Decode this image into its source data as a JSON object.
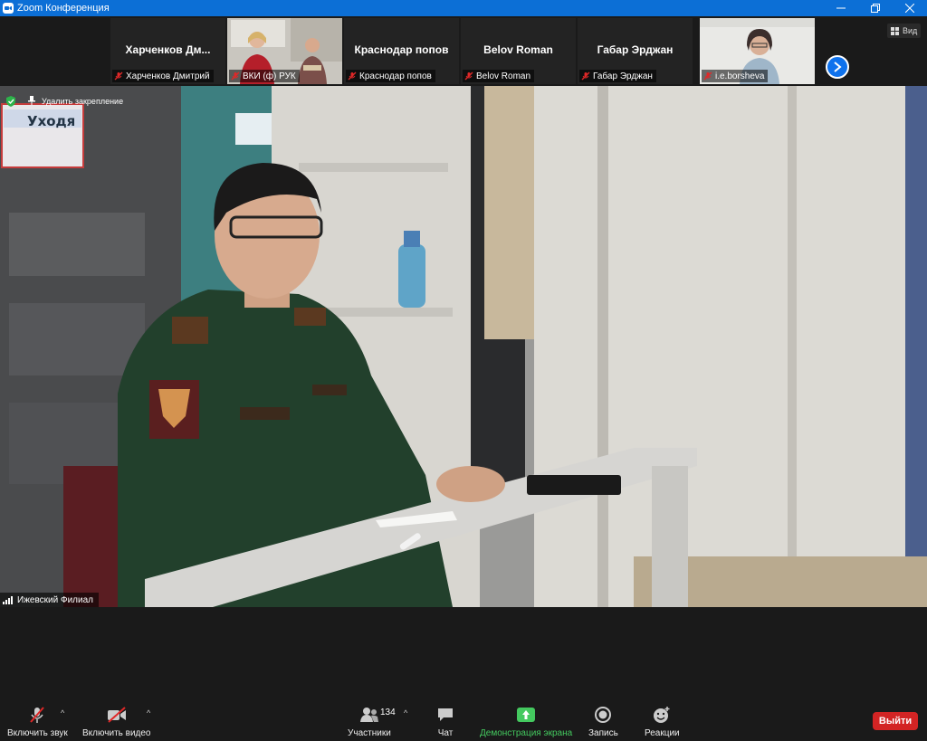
{
  "window": {
    "title": "Zoom Конференция"
  },
  "participants_strip": [
    {
      "big_name": "Харченков  Дм...",
      "label": "Харченков Дмитрий",
      "has_video": false,
      "muted": true
    },
    {
      "big_name": "",
      "label": "ВКИ (ф) РУК",
      "has_video": true,
      "muted": true
    },
    {
      "big_name": "Краснодар попов",
      "label": "Краснодар попов",
      "has_video": false,
      "muted": true
    },
    {
      "big_name": "Belov Roman",
      "label": "Belov Roman",
      "has_video": false,
      "muted": true
    },
    {
      "big_name": "Габар Эрджан",
      "label": "Габар Эрджан",
      "has_video": false,
      "muted": true
    },
    {
      "big_name": "",
      "label": "i.e.borsheva",
      "has_video": true,
      "muted": true
    }
  ],
  "view_button": {
    "label": "Вид"
  },
  "pinned": {
    "unpin_label": "Удалить закрепление",
    "speaker_name": "Ижевский Филиал",
    "sign_text": "Уходя"
  },
  "toolbar": {
    "audio_label": "Включить звук",
    "video_label": "Включить видео",
    "participants_label": "Участники",
    "participants_count": "134",
    "chat_label": "Чат",
    "share_label": "Демонстрация экрана",
    "record_label": "Запись",
    "reactions_label": "Реакции",
    "leave_label": "Выйти"
  },
  "colors": {
    "title_bar": "#0c6fd6",
    "share_green": "#44c95f",
    "leave_red": "#d32424",
    "muted_red": "#e02828"
  }
}
